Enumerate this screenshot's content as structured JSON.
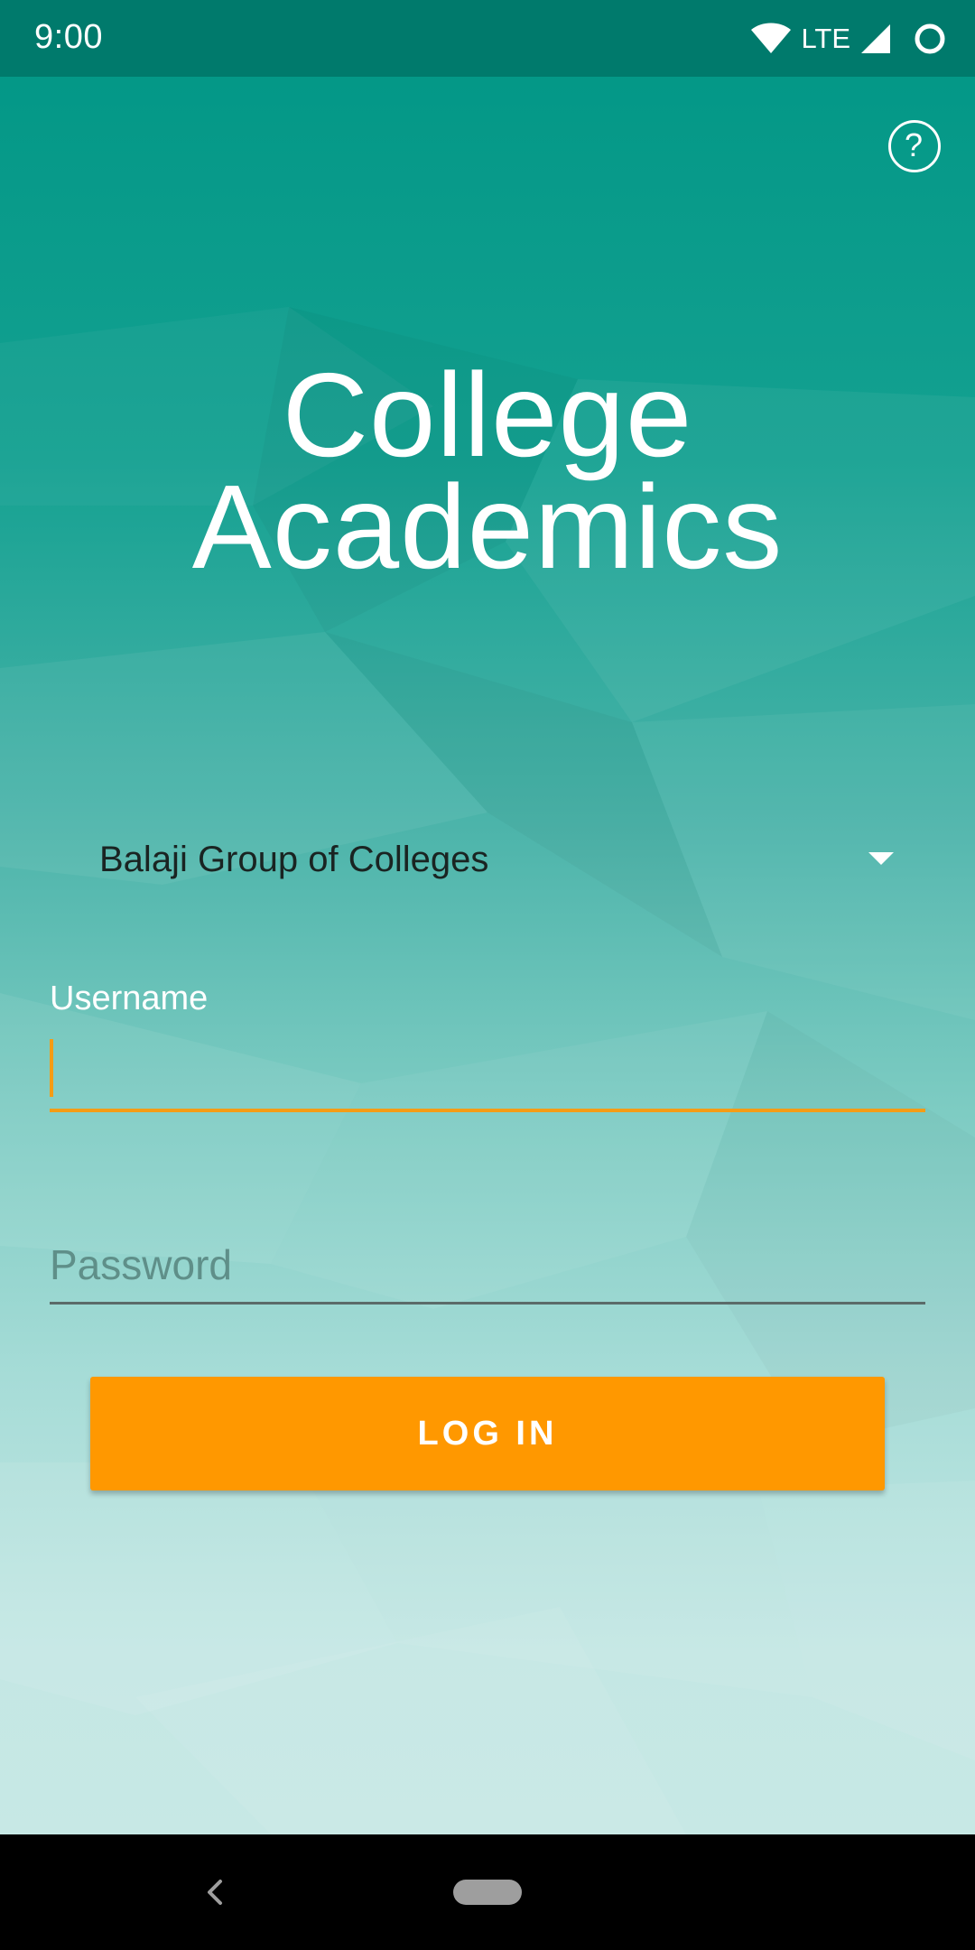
{
  "status_bar": {
    "time": "9:00",
    "network": "LTE",
    "icons": [
      "wifi-icon",
      "cell-signal-icon",
      "circle-status-icon"
    ]
  },
  "header": {
    "help_icon_glyph": "?",
    "title_line1": "College",
    "title_line2": "Academics"
  },
  "form": {
    "college_selected": "Balaji Group of Colleges",
    "username_label": "Username",
    "username_value": "",
    "password_placeholder": "Password",
    "login_label": "LOG IN"
  },
  "colors": {
    "primary_teal": "#009685",
    "status_bar": "#007a6c",
    "accent_orange": "#ff9800"
  }
}
